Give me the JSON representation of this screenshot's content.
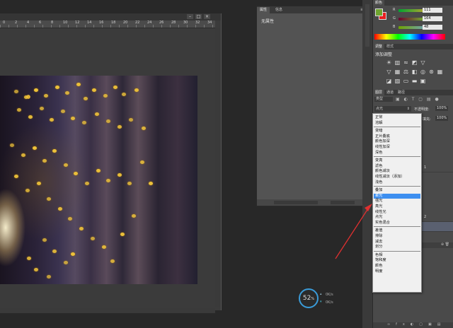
{
  "ruler": {
    "labels": [
      "0",
      "2",
      "4",
      "6",
      "8",
      "10",
      "12",
      "14",
      "16",
      "18",
      "20",
      "22",
      "24",
      "26",
      "28",
      "30",
      "32",
      "34"
    ]
  },
  "properties": {
    "tabs": [
      "属性",
      "信息"
    ],
    "body_text": "无属性",
    "footer_fields": [
      "",
      ""
    ]
  },
  "color_panel": {
    "tabs": [
      "颜色",
      ""
    ],
    "r_label": "R",
    "g_label": "G",
    "b_label": "B",
    "r_value": "111",
    "g_value": "164",
    "b_value": "48",
    "foreground_color": "#6fa430",
    "background_color": "#e82020"
  },
  "adjust_panel": {
    "tabs": [
      "调整",
      "样式"
    ],
    "title": "添加调整",
    "icon_rows": [
      [
        "brightness-icon",
        "levels-icon",
        "curves-icon",
        "exposure-icon",
        "triangle-icon"
      ],
      [
        "vibrance-icon",
        "hue-icon",
        "color-balance-icon",
        "bw-icon",
        "photo-filter-icon",
        "channel-mixer-icon",
        "color-lookup-icon"
      ],
      [
        "invert-icon",
        "posterize-icon",
        "threshold-icon",
        "gradient-map-icon",
        "selective-color-icon"
      ]
    ]
  },
  "layers_panel": {
    "tabs": [
      "图层",
      "通道",
      "路径"
    ],
    "filter_label": "类型",
    "blend_mode": "点光",
    "opacity_label": "不透明度:",
    "opacity_value": "100%",
    "fill_label": "填充:",
    "fill_value": "100%",
    "partial_labels": [
      "1",
      "2"
    ]
  },
  "blend_menu": {
    "groups": [
      [
        "正常",
        "溶解"
      ],
      [
        "变暗",
        "正片叠底",
        "颜色加深",
        "线性加深",
        "深色"
      ],
      [
        "变亮",
        "滤色",
        "颜色减淡",
        "线性减淡（添加）",
        "浅色"
      ],
      [
        "叠加",
        "柔光",
        "强光",
        "亮光",
        "线性光",
        "点光",
        "实色混合"
      ],
      [
        "差值",
        "排除",
        "减去",
        "划分"
      ],
      [
        "色相",
        "饱和度",
        "颜色",
        "明度"
      ]
    ],
    "selected": "柔光"
  },
  "network": {
    "percent": "52",
    "unit": "%",
    "up": "0K/s",
    "down": "0K/s"
  },
  "colors": {
    "accent_blue": "#3d8ff0",
    "arrow_red": "#e03030",
    "net_ring": "#3a9bd8"
  }
}
